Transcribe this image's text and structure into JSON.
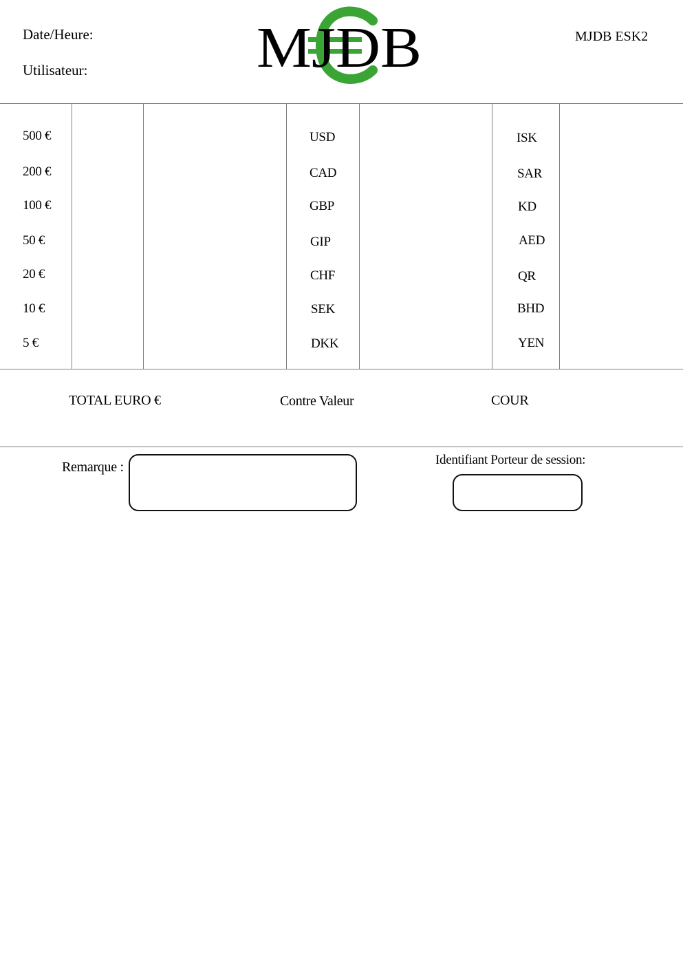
{
  "header": {
    "date_label": "Date/Heure:",
    "user_label": "Utilisateur:",
    "doc_id": "MJDB ESK2",
    "logo": {
      "text": "MJDB",
      "emblem": "euro-sign",
      "emblem_color": "#3aa435"
    }
  },
  "grid": {
    "euro_denominations": [
      "500 €",
      "200 €",
      "100 €",
      "50 €",
      "20 €",
      "10 €",
      "5 €"
    ],
    "currencies_a": [
      "USD",
      "CAD",
      "GBP",
      "GIP",
      "CHF",
      "SEK",
      "DKK"
    ],
    "currencies_b": [
      "ISK",
      "SAR",
      "KD",
      "AED",
      "QR",
      "BHD",
      "YEN"
    ]
  },
  "totals": {
    "total_euro": "TOTAL EURO €",
    "contre_valeur": "Contre Valeur",
    "cour": "COUR"
  },
  "footer": {
    "remark_label": "Remarque :",
    "session_label": "Identifiant Porteur de session:",
    "remark_value": "",
    "session_value": ""
  }
}
